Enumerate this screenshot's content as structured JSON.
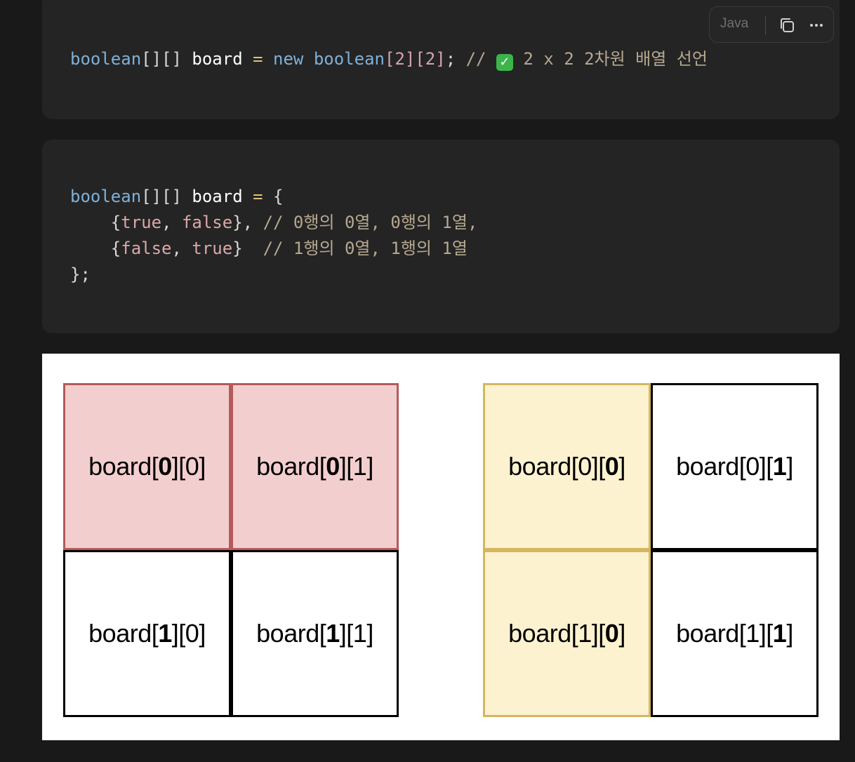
{
  "code_block_1": {
    "language_label": "Java",
    "line": {
      "type1": "boolean",
      "brackets1": "[][]",
      "var": "board",
      "eq": "=",
      "kw_new": "new",
      "type2": "boolean",
      "dims": "[2][2]",
      "semi": ";",
      "comment_prefix": "//",
      "comment_text": "2 x 2 2차원 배열 선언"
    }
  },
  "code_block_2": {
    "line1": {
      "type": "boolean",
      "brackets": "[][]",
      "var": "board",
      "eq": "=",
      "open": "{"
    },
    "line2": {
      "open": "{",
      "v1": "true",
      "comma": ",",
      "v2": "false",
      "close": "},",
      "comment": "// 0행의 0열, 0행의 1열,"
    },
    "line3": {
      "open": "{",
      "v1": "false",
      "comma": ",",
      "v2": "true",
      "close": "}",
      "comment": "// 1행의 0열, 1행의 1열"
    },
    "line4": "};"
  },
  "diagram": {
    "left_grid": {
      "highlight_color": "#f2cfce",
      "cells": [
        {
          "pre": "board[",
          "a": "0",
          "mid": "][",
          "b": "0",
          "post": "]",
          "bold": "a"
        },
        {
          "pre": "board[",
          "a": "0",
          "mid": "][",
          "b": "1",
          "post": "]",
          "bold": "a"
        },
        {
          "pre": "board[",
          "a": "1",
          "mid": "][",
          "b": "0",
          "post": "]",
          "bold": "a"
        },
        {
          "pre": "board[",
          "a": "1",
          "mid": "][",
          "b": "1",
          "post": "]",
          "bold": "a"
        }
      ]
    },
    "right_grid": {
      "highlight_color": "#fdf2d0",
      "cells": [
        {
          "pre": "board[",
          "a": "0",
          "mid": "][",
          "b": "0",
          "post": "]",
          "bold": "b"
        },
        {
          "pre": "board[",
          "a": "0",
          "mid": "][",
          "b": "1",
          "post": "]",
          "bold": "b"
        },
        {
          "pre": "board[",
          "a": "1",
          "mid": "][",
          "b": "0",
          "post": "]",
          "bold": "b"
        },
        {
          "pre": "board[",
          "a": "1",
          "mid": "][",
          "b": "1",
          "post": "]",
          "bold": "b"
        }
      ]
    }
  },
  "icons": {
    "copy": "copy-icon",
    "more": "more-options-icon",
    "check": "check-mark-icon"
  }
}
